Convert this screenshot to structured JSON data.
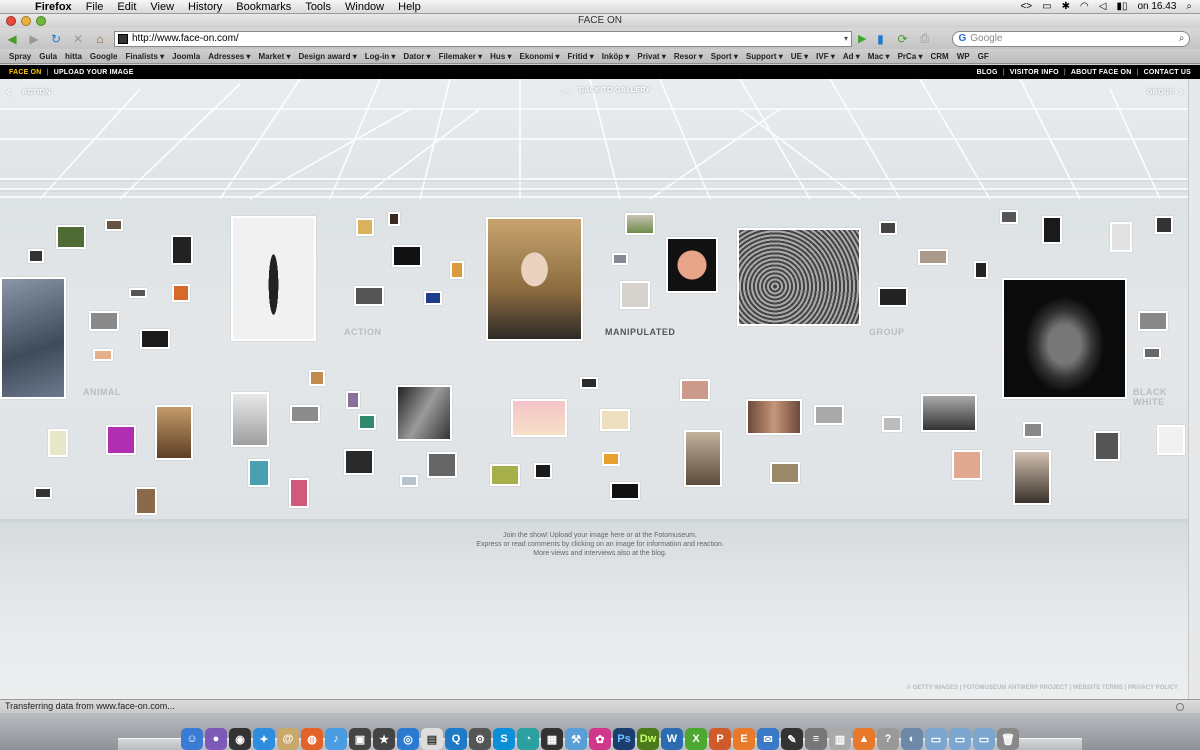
{
  "menubar": {
    "app": "Firefox",
    "items": [
      "File",
      "Edit",
      "View",
      "History",
      "Bookmarks",
      "Tools",
      "Window",
      "Help"
    ],
    "clock": "on 16.43"
  },
  "window": {
    "title": "FACE ON"
  },
  "urlbar": {
    "url": "http://www.face-on.com/",
    "search_placeholder": "Google"
  },
  "bookmarks": [
    "Spray",
    "Gula",
    "hitta",
    "Google",
    "Finalists ▾",
    "Joomla",
    "Adresses ▾",
    "Market ▾",
    "Design award ▾",
    "Log-in ▾",
    "Dator ▾",
    "Filemaker ▾",
    "Hus ▾",
    "Ekonomi ▾",
    "Fritid ▾",
    "Inköp ▾",
    "Privat ▾",
    "Resor ▾",
    "Sport ▾",
    "Support ▾",
    "UE ▾",
    "IVF ▾",
    "Ad ▾",
    "Mac ▾",
    "PrCa ▾",
    "CRM",
    "WP",
    "GF"
  ],
  "site": {
    "brand": "FACE ON",
    "upload": "UPLOAD YOUR IMAGE",
    "right_links": [
      "BLOG",
      "VISITOR INFO",
      "ABOUT FACE ON",
      "CONTACT US"
    ],
    "prev": "ACTION",
    "back": "BACK TO GALLERY",
    "next": "GROUP",
    "categories": {
      "animal": "ANIMAL",
      "action": "ACTION",
      "manipulated": "MANIPULATED",
      "group": "GROUP",
      "black_white": "BLACK WHITE"
    },
    "info_lines": [
      "Join the show! Upload your image here or at the Fotomuseum.",
      "Express or read comments by clicking on an image for information and reaction.",
      "More views and interviews also at the blog."
    ],
    "footer": "© GETTY IMAGES | FOTOMUSEUM ANTWERP PROJECT | WEBSITE TERMS | PRIVACY POLICY"
  },
  "status": {
    "text": "Transferring data from www.face-on.com..."
  },
  "colors": {
    "brand_yellow": "#ffcc00",
    "header_bg": "#000000",
    "wall": "#e3e7e9"
  }
}
